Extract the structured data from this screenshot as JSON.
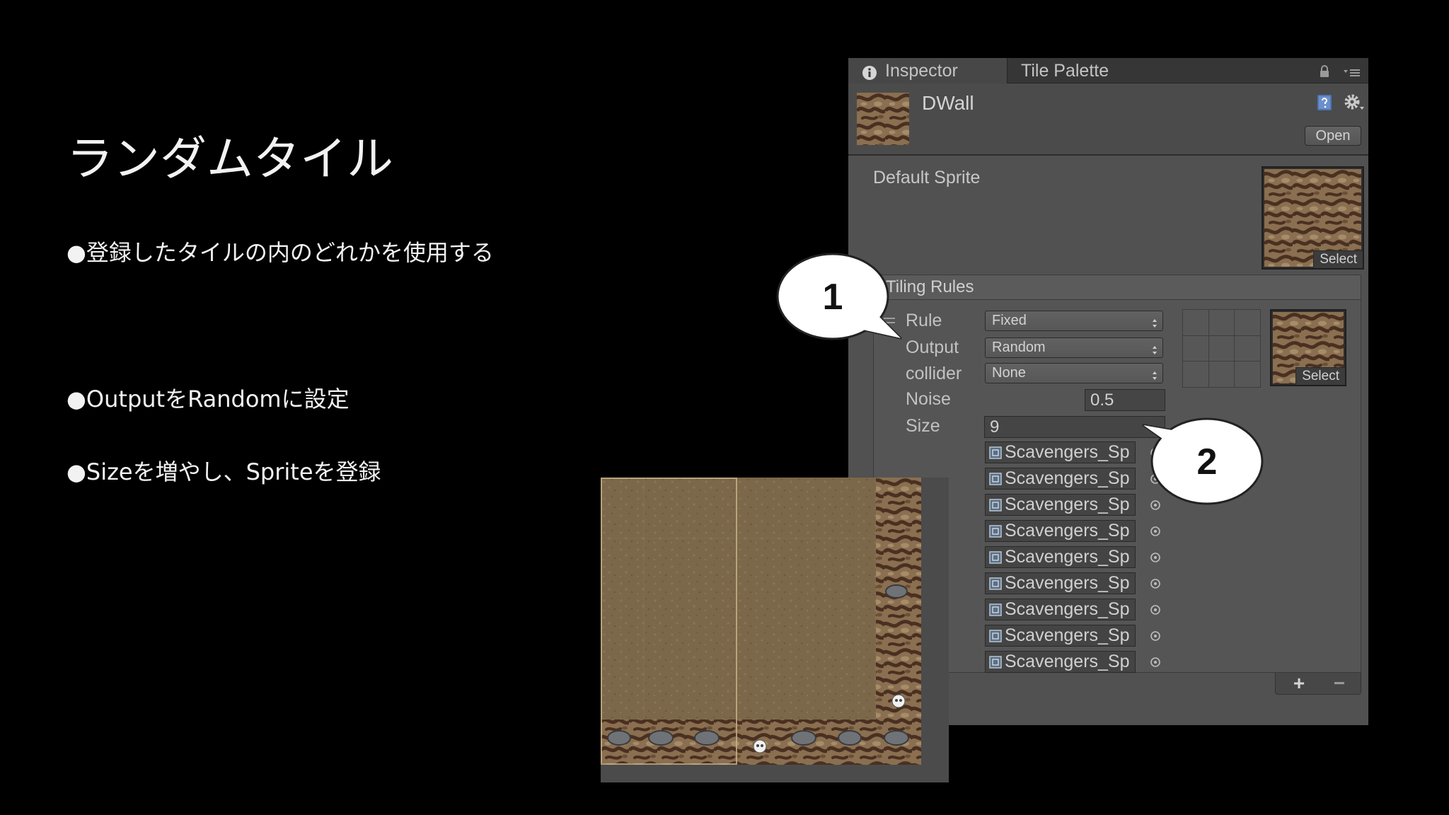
{
  "colors": {
    "slide_background": "#000000",
    "slide_text": "#f2f2f2",
    "panel_background": "#515151",
    "tab_bar": "#363636",
    "field_background": "#454545",
    "panel_text": "#c4c4c4",
    "help_icon": "#4f74b0",
    "callout_fill": "#ffffff",
    "callout_stroke": "#222222"
  },
  "slide": {
    "title": "ランダムタイル",
    "bullets": [
      "●登録したタイルの内のどれかを使用する",
      "●OutputをRandomに設定",
      "●Sizeを増やし、Spriteを登録"
    ]
  },
  "inspector": {
    "tabs": [
      {
        "label": "Inspector",
        "icon": "info-icon",
        "active": true
      },
      {
        "label": "Tile Palette",
        "active": false
      }
    ],
    "tab_bar_icons": [
      "lock-icon",
      "menu-icon"
    ],
    "asset": {
      "name": "DWall",
      "icons": [
        "help-icon",
        "gear-icon"
      ],
      "open_label": "Open"
    },
    "default_sprite": {
      "label": "Default Sprite",
      "select_label": "Select"
    },
    "tiling_rules": {
      "title": "Tiling Rules",
      "rule": {
        "rule": {
          "label": "Rule",
          "value": "Fixed"
        },
        "output": {
          "label": "Output",
          "value": "Random"
        },
        "collider": {
          "label": "collider",
          "value": "None"
        },
        "noise": {
          "label": "Noise",
          "value": "0.5"
        },
        "size": {
          "label": "Size",
          "value": "9"
        },
        "sprites": [
          "Scavengers_Sp",
          "Scavengers_Sp",
          "Scavengers_Sp",
          "Scavengers_Sp",
          "Scavengers_Sp",
          "Scavengers_Sp",
          "Scavengers_Sp",
          "Scavengers_Sp",
          "Scavengers_Sp"
        ],
        "sprite_icon": "sprite-icon",
        "picker_icon": "object-picker-icon",
        "neighbor_grid_cells": 9,
        "sprite_select_label": "Select"
      },
      "add_label": "+",
      "remove_label": "−"
    }
  },
  "callouts": [
    {
      "number": "1"
    },
    {
      "number": "2"
    }
  ]
}
